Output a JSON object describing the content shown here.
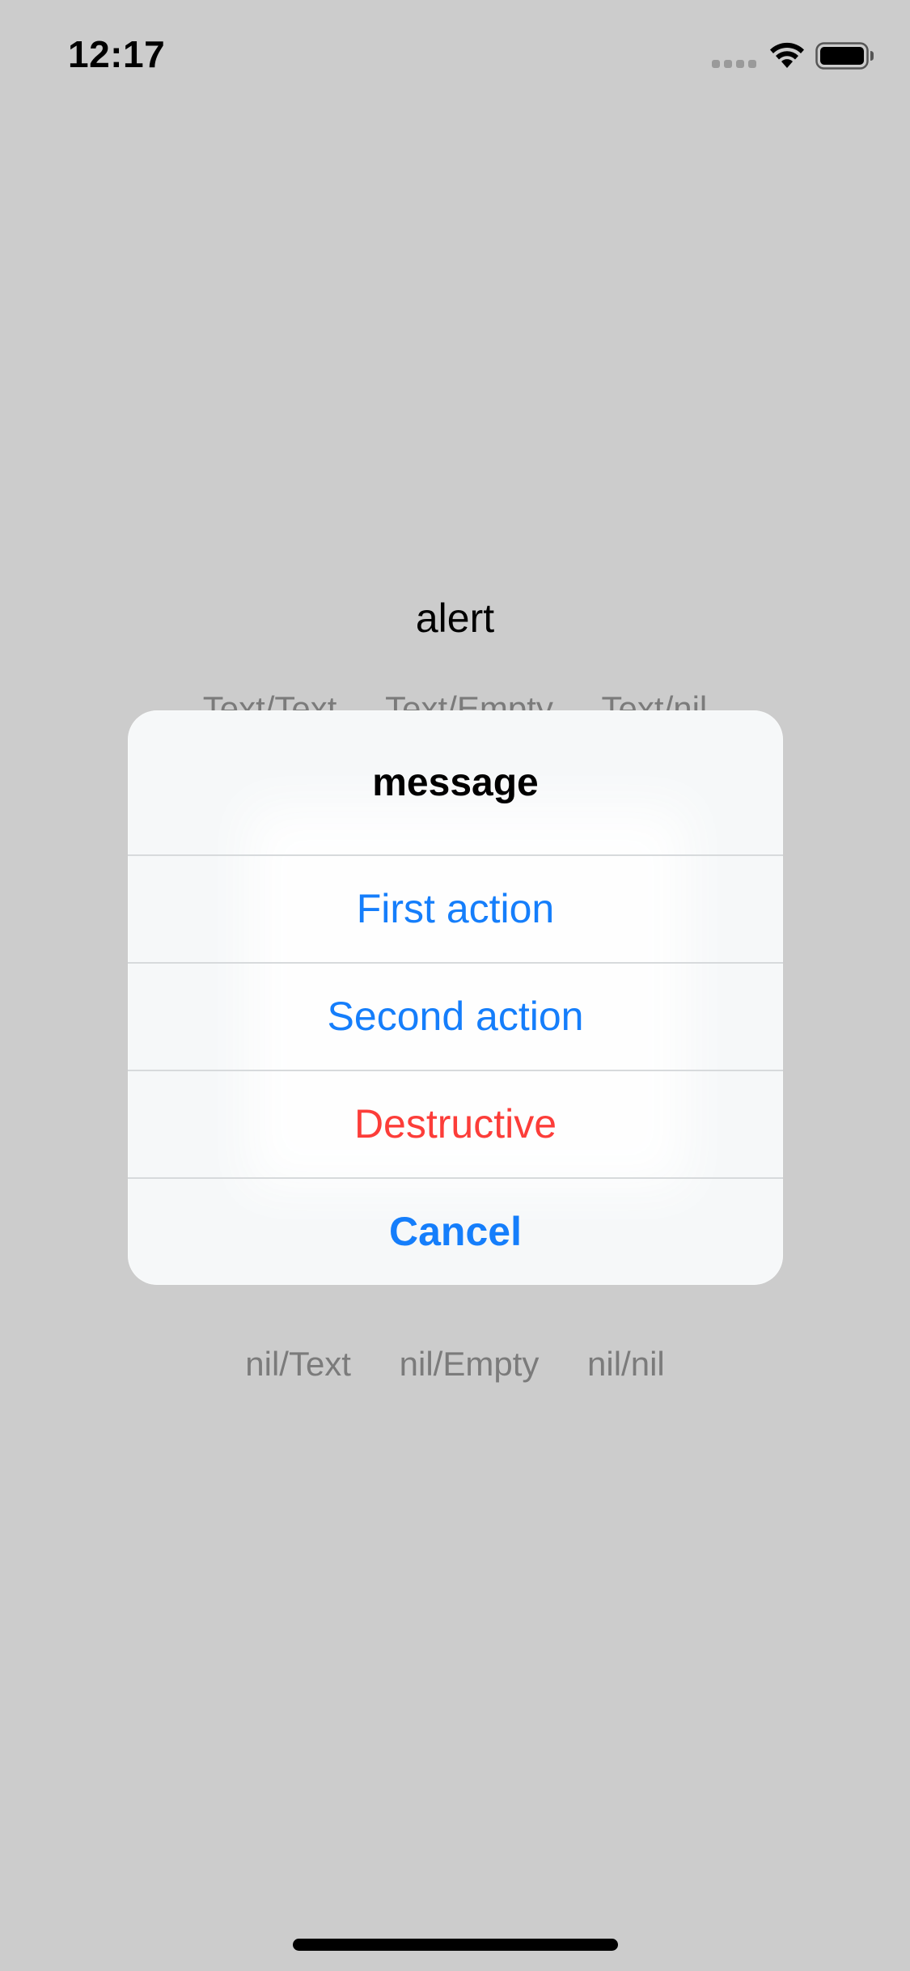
{
  "status_bar": {
    "time": "12:17"
  },
  "background": {
    "title": "alert",
    "row1": [
      "Text/Text",
      "Text/Empty",
      "Text/nil"
    ],
    "row2": [
      "nil/Text",
      "nil/Empty",
      "nil/nil"
    ]
  },
  "alert": {
    "message": "message",
    "actions": {
      "first": "First action",
      "second": "Second action",
      "destructive": "Destructive",
      "cancel": "Cancel"
    }
  },
  "colors": {
    "background": "#cccccc",
    "action_blue": "#157efb",
    "destructive_red": "#fc3d39",
    "secondary_text": "#7b7b7b"
  },
  "icons": [
    "signal-icon",
    "wifi-icon",
    "battery-icon"
  ]
}
